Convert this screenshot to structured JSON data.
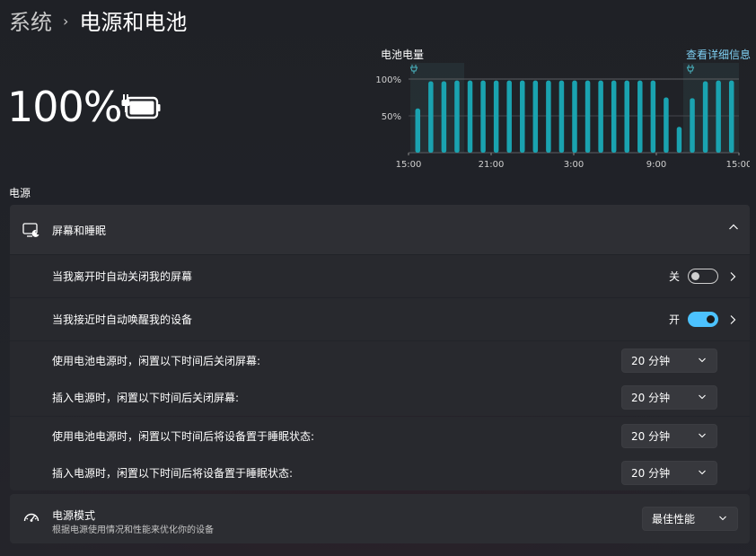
{
  "breadcrumb": {
    "parent": "系统",
    "separator": "›",
    "current": "电源和电池"
  },
  "battery": {
    "percent_label": "100%",
    "icon": "battery-charging-icon"
  },
  "chart": {
    "title": "电池电量",
    "details_link": "查看详细信息"
  },
  "chart_data": {
    "type": "bar",
    "title": "电池电量",
    "y_tick_labels": [
      "100%",
      "50%"
    ],
    "x_tick_labels": [
      "15:00",
      "21:00",
      "3:00",
      "9:00",
      "15:00"
    ],
    "ylim": [
      0,
      100
    ],
    "values": [
      60,
      97,
      97,
      98,
      98,
      98,
      98,
      98,
      98,
      98,
      98,
      98,
      98,
      98,
      98,
      98,
      98,
      98,
      98,
      75,
      35,
      74,
      97,
      98,
      98
    ],
    "charging_markers": [
      "15:00",
      "11:00"
    ],
    "bar_color": "#1aa3b0",
    "grid": true
  },
  "section_label": "电源",
  "screen_sleep": {
    "title": "屏幕和睡眠",
    "icon": "screen-sleep-icon",
    "rows": {
      "auto_off": {
        "label": "当我离开时自动关闭我的屏幕",
        "state_text": "关"
      },
      "auto_wake": {
        "label": "当我接近时自动唤醒我的设备",
        "state_text": "开"
      },
      "battery_screen": {
        "label": "使用电池电源时，闲置以下时间后关闭屏幕:",
        "value": "20 分钟"
      },
      "plugged_screen": {
        "label": "插入电源时，闲置以下时间后关闭屏幕:",
        "value": "20 分钟"
      },
      "battery_sleep": {
        "label": "使用电池电源时，闲置以下时间后将设备置于睡眠状态:",
        "value": "20 分钟"
      },
      "plugged_sleep": {
        "label": "插入电源时，闲置以下时间后将设备置于睡眠状态:",
        "value": "20 分钟"
      }
    }
  },
  "power_mode": {
    "title": "电源模式",
    "subtitle": "根据电源使用情况和性能来优化你的设备",
    "icon": "power-mode-gauge-icon",
    "value": "最佳性能"
  },
  "colors": {
    "accent": "#4cc2ff",
    "link": "#7fd0f3",
    "bar": "#1aa3b0"
  }
}
